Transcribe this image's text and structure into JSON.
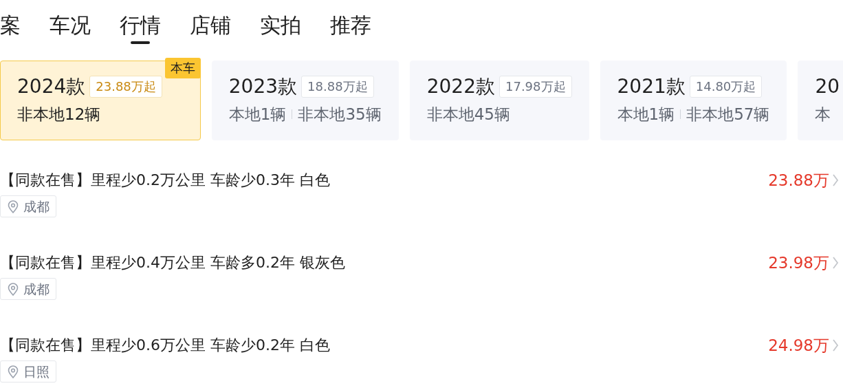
{
  "tabs": [
    {
      "label": "案",
      "selected": false
    },
    {
      "label": "车况",
      "selected": false
    },
    {
      "label": "行情",
      "selected": true
    },
    {
      "label": "店铺",
      "selected": false
    },
    {
      "label": "实拍",
      "selected": false
    },
    {
      "label": "推荐",
      "selected": false
    }
  ],
  "model_years": [
    {
      "year": "2024款",
      "price": "23.88万起",
      "counts": [
        "非本地12辆"
      ],
      "selected": true,
      "badge": "本车"
    },
    {
      "year": "2023款",
      "price": "18.88万起",
      "counts": [
        "本地1辆",
        "非本地35辆"
      ],
      "selected": false
    },
    {
      "year": "2022款",
      "price": "17.98万起",
      "counts": [
        "非本地45辆"
      ],
      "selected": false
    },
    {
      "year": "2021款",
      "price": "14.80万起",
      "counts": [
        "本地1辆",
        "非本地57辆"
      ],
      "selected": false
    },
    {
      "year": "20",
      "counts": [
        "本"
      ],
      "selected": false
    }
  ],
  "listings": [
    {
      "title": "【同款在售】里程少0.2万公里 车龄少0.3年 白色",
      "price": "23.88万",
      "city": "成都"
    },
    {
      "title": "【同款在售】里程少0.4万公里 车龄多0.2年 银灰色",
      "price": "23.98万",
      "city": "成都"
    },
    {
      "title": "【同款在售】里程少0.6万公里 车龄少0.2年 白色",
      "price": "24.98万",
      "city": "日照"
    }
  ]
}
